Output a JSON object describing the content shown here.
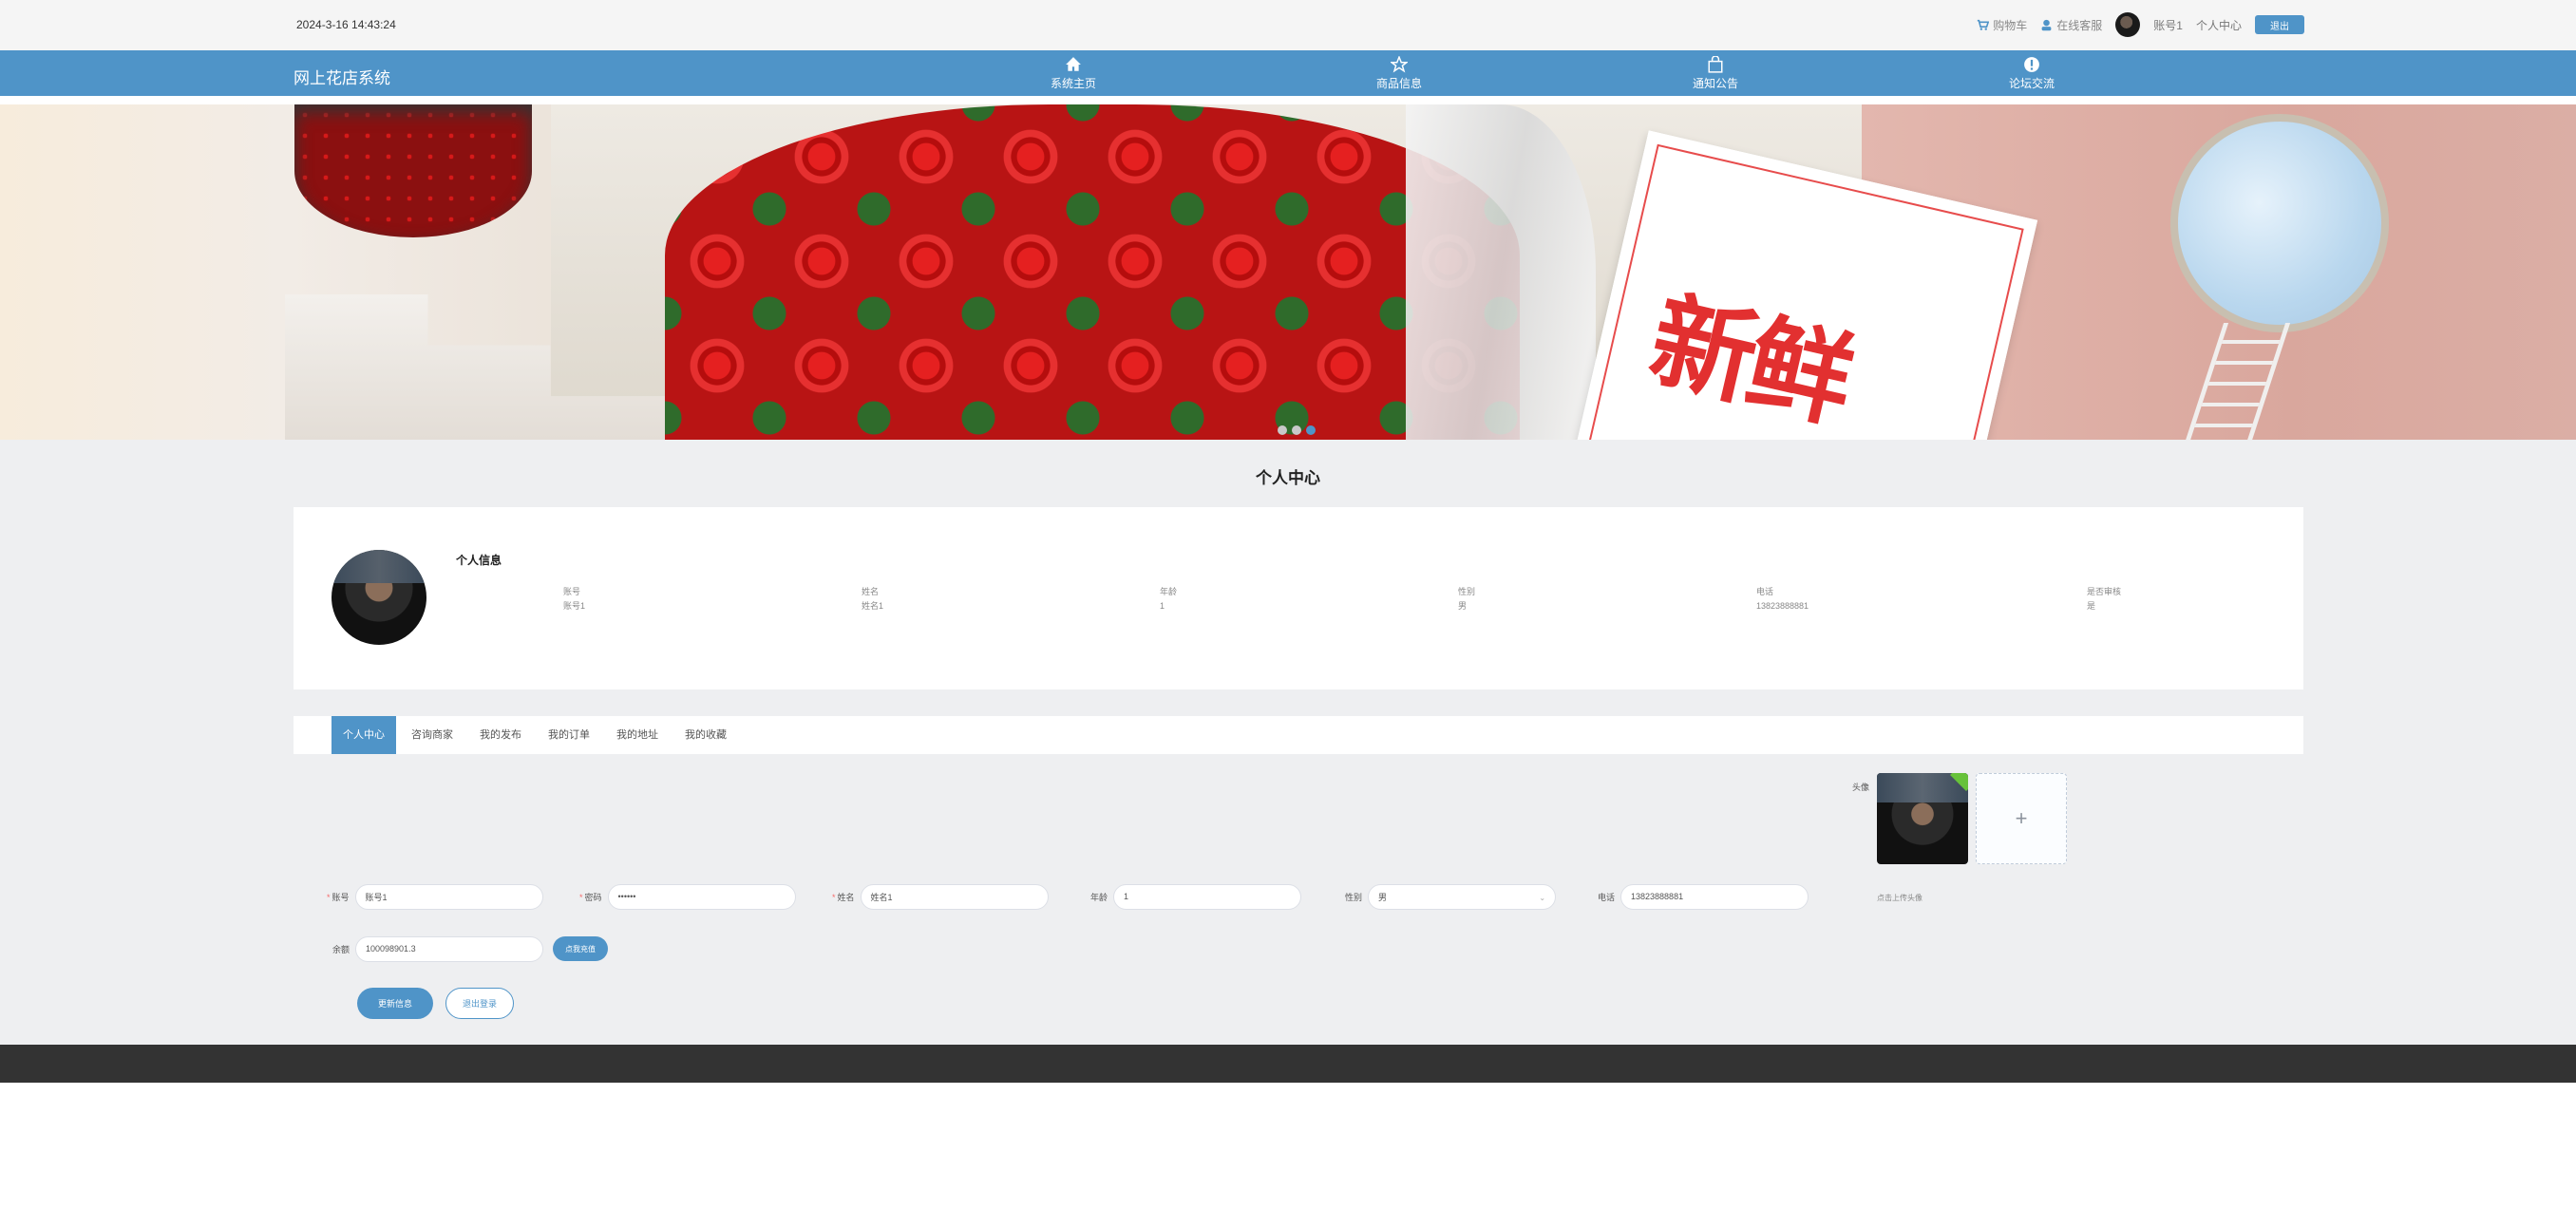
{
  "topbar": {
    "datetime": "2024-3-16 14:43:24",
    "cart": "购物车",
    "service": "在线客服",
    "username": "账号1",
    "user_center": "个人中心",
    "logout": "退出"
  },
  "nav": {
    "brand": "网上花店系统",
    "items": [
      {
        "label": "系统主页",
        "icon": "home-icon"
      },
      {
        "label": "商品信息",
        "icon": "star-icon"
      },
      {
        "label": "通知公告",
        "icon": "bag-icon"
      },
      {
        "label": "论坛交流",
        "icon": "exclamation-icon"
      }
    ]
  },
  "banner": {
    "card_text": "新鲜",
    "slides": 3,
    "active_slide": 3
  },
  "page": {
    "title": "个人中心"
  },
  "info": {
    "title": "个人信息",
    "fields": [
      {
        "label": "账号",
        "value": "账号1"
      },
      {
        "label": "姓名",
        "value": "姓名1"
      },
      {
        "label": "年龄",
        "value": "1"
      },
      {
        "label": "性别",
        "value": "男"
      },
      {
        "label": "电话",
        "value": "13823888881"
      },
      {
        "label": "是否审核",
        "value": "是"
      }
    ]
  },
  "tabs": [
    "个人中心",
    "咨询商家",
    "我的发布",
    "我的订单",
    "我的地址",
    "我的收藏"
  ],
  "form": {
    "avatar_label": "头像",
    "upload_plus": "+",
    "upload_tip": "点击上传头像",
    "account_label": "账号",
    "account_value": "账号1",
    "password_label": "密码",
    "password_value": "••••••",
    "name_label": "姓名",
    "name_value": "姓名1",
    "age_label": "年龄",
    "age_value": "1",
    "gender_label": "性别",
    "gender_value": "男",
    "phone_label": "电话",
    "phone_value": "13823888881",
    "balance_label": "余额",
    "balance_value": "100098901.3",
    "recharge": "点我充值",
    "update": "更新信息",
    "exit": "退出登录"
  },
  "colors": {
    "primary": "#4f94c8",
    "footer": "#333333",
    "page_bg": "#eeeff1"
  }
}
